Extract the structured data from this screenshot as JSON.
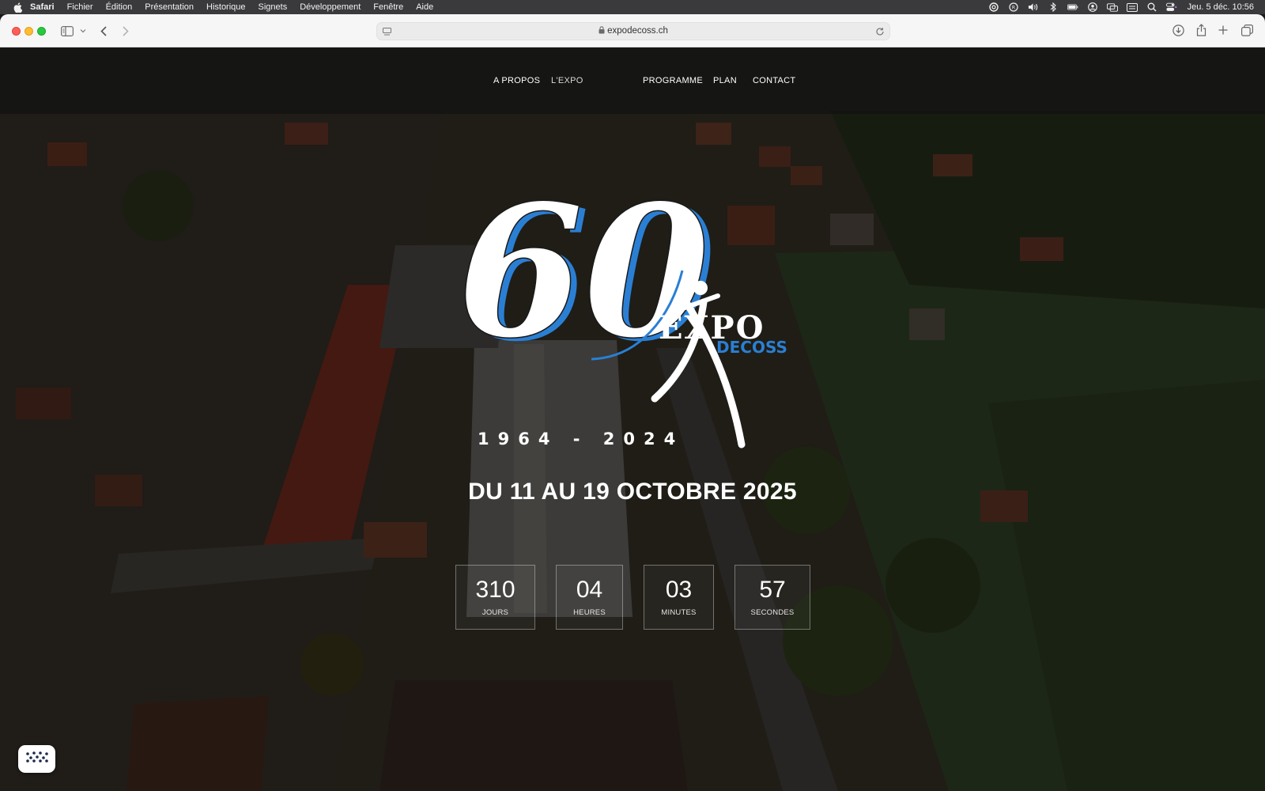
{
  "menubar": {
    "app_name": "Safari",
    "items": [
      "Fichier",
      "Édition",
      "Présentation",
      "Historique",
      "Signets",
      "Développement",
      "Fenêtre",
      "Aide"
    ],
    "status_icons": [
      "creative-cloud-icon",
      "notch-app-icon",
      "volume-icon",
      "bluetooth-icon",
      "battery-icon",
      "user-icon",
      "screen-mirroring-icon",
      "keyboard-layout-icon",
      "spotlight-search-icon",
      "control-center-icon"
    ],
    "clock": "Jeu. 5 déc.  10:56"
  },
  "browser": {
    "url": "expodecoss.ch",
    "icons": [
      "sidebar-icon",
      "chevron-down-icon",
      "back-icon",
      "forward-icon",
      "reader-icon",
      "lock-icon",
      "reload-icon",
      "download-icon",
      "share-icon",
      "new-tab-icon",
      "tab-overview-icon"
    ]
  },
  "site": {
    "nav": [
      "A PROPOS",
      "L'EXPO",
      "PROGRAMME",
      "PLAN",
      "CONTACT"
    ],
    "logo": {
      "number": "60",
      "years": "1964 - 2024",
      "brand_top": "EXPO",
      "brand_bottom": "DECOSS"
    },
    "headline": "DU 11 AU 19 OCTOBRE 2025",
    "countdown": [
      {
        "value": "310",
        "label": "JOURS"
      },
      {
        "value": "04",
        "label": "HEURES"
      },
      {
        "value": "03",
        "label": "MINUTES"
      },
      {
        "value": "57",
        "label": "SECONDES"
      }
    ],
    "cookie_icon": "cookie-icon"
  },
  "colors": {
    "brand_blue": "#2a7fd4",
    "nav_bar": "#121212",
    "menu_bar": "#3a3a3c",
    "toolbar": "#f6f6f6"
  }
}
